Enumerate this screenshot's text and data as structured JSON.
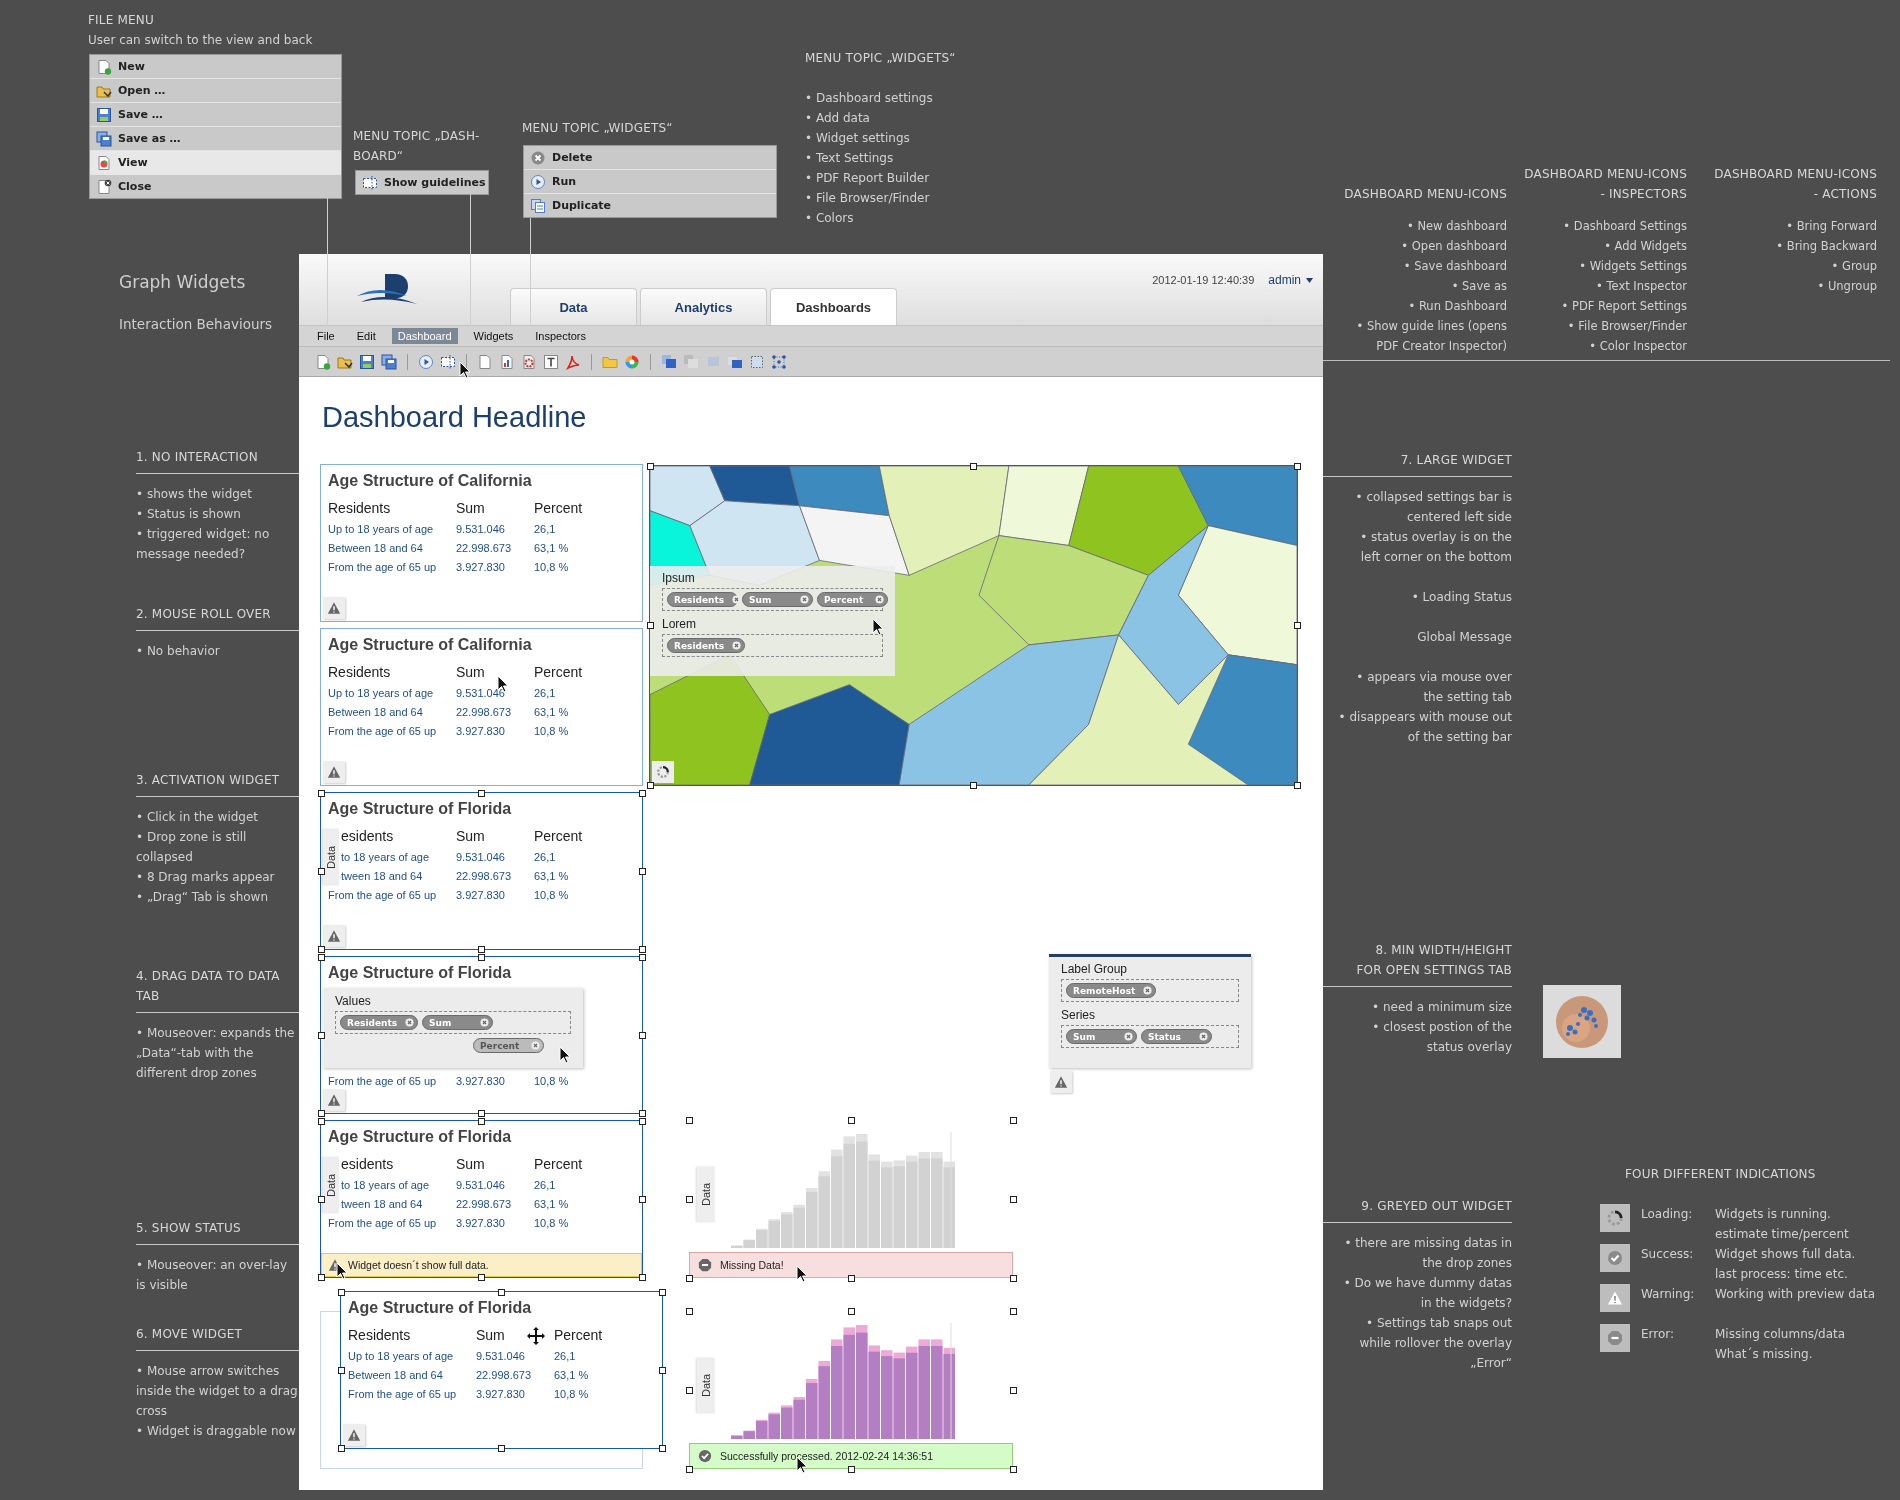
{
  "file_menu": {
    "title": "FILE MENU",
    "subtitle": "User can switch to the view and back",
    "items": [
      {
        "label": "New",
        "selected": false
      },
      {
        "label": "Open …",
        "selected": false
      },
      {
        "label": "Save …",
        "selected": false
      },
      {
        "label": "Save as …",
        "selected": false
      },
      {
        "label": "View",
        "selected": true
      },
      {
        "label": "Close",
        "selected": false
      }
    ]
  },
  "dashboard_menu": {
    "title": "MENU TOPIC „DASH-BOARD“",
    "items": [
      {
        "label": "Show guidelines"
      }
    ]
  },
  "widgets_menu": {
    "title": "MENU TOPIC „WIDGETS“",
    "items": [
      {
        "label": "Delete"
      },
      {
        "label": "Run"
      },
      {
        "label": "Duplicate"
      }
    ]
  },
  "widgets_topic": {
    "title": "MENU TOPIC „WIDGETS“",
    "bullets": [
      "• Dashboard settings",
      "• Add data",
      "• Widget settings",
      "• Text Settings",
      "• PDF Report Builder",
      "• File Browser/Finder",
      "• Colors"
    ]
  },
  "menu_icon_columns": [
    {
      "title_lines": [
        "DASHBOARD MENU-ICONS"
      ],
      "bullets": [
        "• New dashboard",
        "• Open dashboard",
        "• Save dashboard",
        "• Save as",
        "• Run Dashboard",
        "• Show guide lines (opens PDF Creator Inspector)"
      ]
    },
    {
      "title_lines": [
        "DASHBOARD MENU-ICONS",
        "- INSPECTORS"
      ],
      "bullets": [
        "• Dashboard Settings",
        "• Add Widgets",
        "• Widgets Settings",
        "• Text Inspector",
        "• PDF Report Settings",
        "• File Browser/Finder",
        "• Color Inspector"
      ]
    },
    {
      "title_lines": [
        "DASHBOARD MENU-ICONS",
        "- ACTIONS"
      ],
      "bullets": [
        "• Bring Forward",
        "• Bring Backward",
        "• Group",
        "• Ungroup"
      ]
    }
  ],
  "sheet": {
    "title": "Graph Widgets",
    "subtitle": "Interaction Behaviours"
  },
  "left_notes": [
    {
      "title_lines": [
        "1. NO INTERACTION"
      ],
      "bullets": [
        "• shows the widget",
        "• Status is shown",
        "• triggered widget: no message needed?"
      ]
    },
    {
      "title_lines": [
        "2. MOUSE ROLL OVER"
      ],
      "bullets": [
        "• No behavior"
      ]
    },
    {
      "title_lines": [
        "3. ACTIVATION WIDGET"
      ],
      "bullets": [
        "• Click in the widget",
        "• Drop zone is still collapsed",
        "• 8 Drag marks appear",
        "• „Drag“ Tab is shown"
      ]
    },
    {
      "title_lines": [
        "4. DRAG DATA TO DATA",
        "TAB"
      ],
      "bullets": [
        "• Mouseover: expands the „Data“-tab with the different drop zones"
      ]
    },
    {
      "title_lines": [
        "5. SHOW STATUS"
      ],
      "bullets": [
        "• Mouseover: an over-lay is visible"
      ]
    },
    {
      "title_lines": [
        "6. MOVE WIDGET"
      ],
      "bullets": [
        "• Mouse arrow switches inside the widget to a drag cross",
        "• Widget is draggable now"
      ]
    }
  ],
  "right_notes": [
    {
      "title_lines": [
        "7. LARGE WIDGET"
      ],
      "blocks": [
        [
          "• collapsed settings bar is centered left side",
          "• status overlay is on the left corner on the bottom"
        ],
        [
          "• Loading Status"
        ],
        [
          "Global Message"
        ],
        [
          "• appears via mouse over the setting tab",
          "• disappears with mouse out of the setting bar"
        ]
      ]
    },
    {
      "title_lines": [
        "8. MIN WIDTH/HEIGHT",
        "FOR OPEN SETTINGS TAB"
      ],
      "blocks": [
        [
          "• need a minimum size",
          "• closest postion of the status overlay"
        ]
      ]
    },
    {
      "title_lines": [
        "9. GREYED OUT WIDGET"
      ],
      "blocks": [
        [
          "• there are missing datas in the drop zones",
          "• Do we have dummy datas in the widgets?",
          "• Settings tab snaps out while rollover the overlay „Error“"
        ]
      ]
    }
  ],
  "app": {
    "timestamp": "2012-01-19 12:40:39",
    "user": "admin",
    "tabs": [
      {
        "label": "Data",
        "selected": false
      },
      {
        "label": "Analytics",
        "selected": false
      },
      {
        "label": "Dashboards",
        "selected": true
      }
    ],
    "menu": [
      {
        "label": "File",
        "selected": false
      },
      {
        "label": "Edit",
        "selected": false
      },
      {
        "label": "Dashboard",
        "selected": true
      },
      {
        "label": "Widgets",
        "selected": false
      },
      {
        "label": "Inspectors",
        "selected": false
      }
    ],
    "headline": "Dashboard Headline"
  },
  "widgets": [
    {
      "kind": "plain",
      "selected": false,
      "title": "Age Structure of California",
      "columns": [
        "Residents",
        "Sum",
        "Percent"
      ],
      "rows": [
        [
          "Up to 18 years of age",
          "9.531.046",
          "26,1"
        ],
        [
          "Between 18 and 64",
          "22.998.673",
          "63,1 %"
        ],
        [
          "From the age of 65 up",
          "3.927.830",
          "10,8 %"
        ]
      ]
    },
    {
      "kind": "hover",
      "selected": false,
      "title": "Age Structure of California",
      "columns": [
        "Residents",
        "Sum",
        "Percent"
      ],
      "rows": [
        [
          "Up to 18 years of age",
          "9.531.046",
          "26,1"
        ],
        [
          "Between 18 and 64",
          "22.998.673",
          "63,1 %"
        ],
        [
          "From the age of 65 up",
          "3.927.830",
          "10,8 %"
        ]
      ]
    },
    {
      "kind": "active",
      "selected": true,
      "title": "Age Structure of Florida",
      "data_tab": "Data",
      "columns": [
        "esidents",
        "Sum",
        "Percent"
      ],
      "rows": [
        [
          "to 18 years of age",
          "9.531.046",
          "26,1"
        ],
        [
          "tween 18 and 64",
          "22.998.673",
          "63,1 %"
        ],
        [
          "From the age of 65 up",
          "3.927.830",
          "10,8 %"
        ]
      ]
    },
    {
      "kind": "dragging",
      "selected": true,
      "title": "Age Structure of Florida",
      "rows": [
        [
          "From the age of 65 up",
          "3.927.830",
          "10,8 %"
        ]
      ],
      "drop_panel": {
        "label": "Values",
        "chips": [
          "Residents",
          "Sum"
        ],
        "dragged_chip": "Percent"
      }
    },
    {
      "kind": "status",
      "selected": true,
      "title": "Age Structure of Florida",
      "data_tab": "Data",
      "columns": [
        "esidents",
        "Sum",
        "Percent"
      ],
      "rows": [
        [
          "to 18 years of age",
          "9.531.046",
          "26,1"
        ],
        [
          "tween 18 and 64",
          "22.998.673",
          "63,1 %"
        ],
        [
          "From the age of 65 up",
          "3.927.830",
          "10,8 %"
        ]
      ],
      "status": "Widget doesn´t show full data."
    },
    {
      "kind": "moving",
      "selected": true,
      "title": "Age Structure of Florida",
      "columns": [
        "Residents",
        "Sum",
        "Percent"
      ],
      "rows": [
        [
          "Up to 18 years of age",
          "9.531.046",
          "26,1"
        ],
        [
          "Between 18 and 64",
          "22.998.673",
          "63,1 %"
        ],
        [
          "From the age of 65 up",
          "3.927.830",
          "10,8 %"
        ]
      ]
    }
  ],
  "map_widget": {
    "groups": [
      {
        "label": "Ipsum",
        "chips": [
          "Residents",
          "Sum",
          "Percent"
        ]
      },
      {
        "label": "Lorem",
        "chips": [
          "Residents"
        ]
      }
    ]
  },
  "settings_widget": {
    "groups": [
      {
        "label": "Label Group",
        "chips": [
          "RemoteHost"
        ]
      },
      {
        "label": "Series",
        "chips": [
          "Sum",
          "Status"
        ]
      }
    ]
  },
  "charts": [
    {
      "data_tab": "Data",
      "status": {
        "kind": "error",
        "text": "Missing Data!"
      }
    },
    {
      "data_tab": "Data",
      "status": {
        "kind": "success",
        "text": "Successfully processed. 2012-02-24 14:36:51"
      }
    }
  ],
  "indications": {
    "title": "FOUR DIFFERENT INDICATIONS",
    "items": [
      {
        "kind": "loading",
        "label": "Loading:",
        "lines": [
          "Widgets is running.",
          "estimate time/percent"
        ]
      },
      {
        "kind": "success",
        "label": "Success:",
        "lines": [
          "Widget shows full data.",
          "last process: time etc."
        ]
      },
      {
        "kind": "warning",
        "label": "Warning:",
        "lines": [
          "Working with preview data"
        ]
      },
      {
        "kind": "error",
        "label": "Error:",
        "lines": [
          "Missing columns/data",
          "What´s missing."
        ]
      }
    ]
  }
}
